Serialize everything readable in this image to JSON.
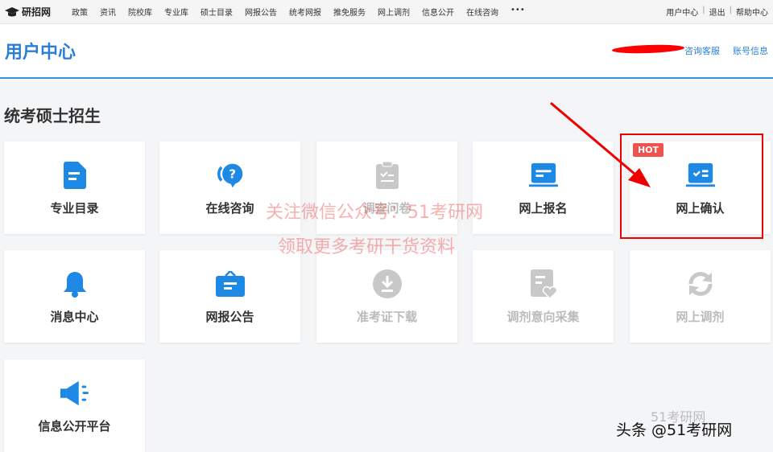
{
  "topbar": {
    "logo": "研招网",
    "nav": [
      "政策",
      "资讯",
      "院校库",
      "专业库",
      "硕士目录",
      "网报公告",
      "统考网报",
      "推免服务",
      "网上调剂",
      "信息公开",
      "在线咨询",
      "•••"
    ],
    "links": [
      "用户中心",
      "退出",
      "帮助中心"
    ]
  },
  "header": {
    "title": "用户中心",
    "links": [
      "咨询客服",
      "账号信息"
    ]
  },
  "section_title": "统考硕士招生",
  "cards": [
    {
      "label": "专业目录",
      "icon": "document-icon",
      "enabled": true
    },
    {
      "label": "在线咨询",
      "icon": "question-bubble-icon",
      "enabled": true
    },
    {
      "label": "调查问卷",
      "icon": "clipboard-check-icon",
      "enabled": false
    },
    {
      "label": "网上报名",
      "icon": "laptop-form-icon",
      "enabled": true
    },
    {
      "label": "网上确认",
      "icon": "laptop-check-icon",
      "enabled": true,
      "badge": "HOT"
    },
    {
      "label": "消息中心",
      "icon": "bell-icon",
      "enabled": true
    },
    {
      "label": "网报公告",
      "icon": "briefcase-icon",
      "enabled": true
    },
    {
      "label": "准考证下载",
      "icon": "download-icon",
      "enabled": false
    },
    {
      "label": "调剂意向采集",
      "icon": "document-heart-icon",
      "enabled": false
    },
    {
      "label": "网上调剂",
      "icon": "refresh-icon",
      "enabled": false
    },
    {
      "label": "信息公开平台",
      "icon": "megaphone-icon",
      "enabled": true
    }
  ],
  "watermark": [
    "关注微信公众号：51考研网",
    "领取更多考研干货资料"
  ],
  "credit": "头条 @51考研网",
  "credit_logo": "51考研网",
  "colors": {
    "accent": "#1e88e5",
    "disabled": "#c8c8c8",
    "hot": "#ef5350",
    "annotation": "#e00000"
  }
}
